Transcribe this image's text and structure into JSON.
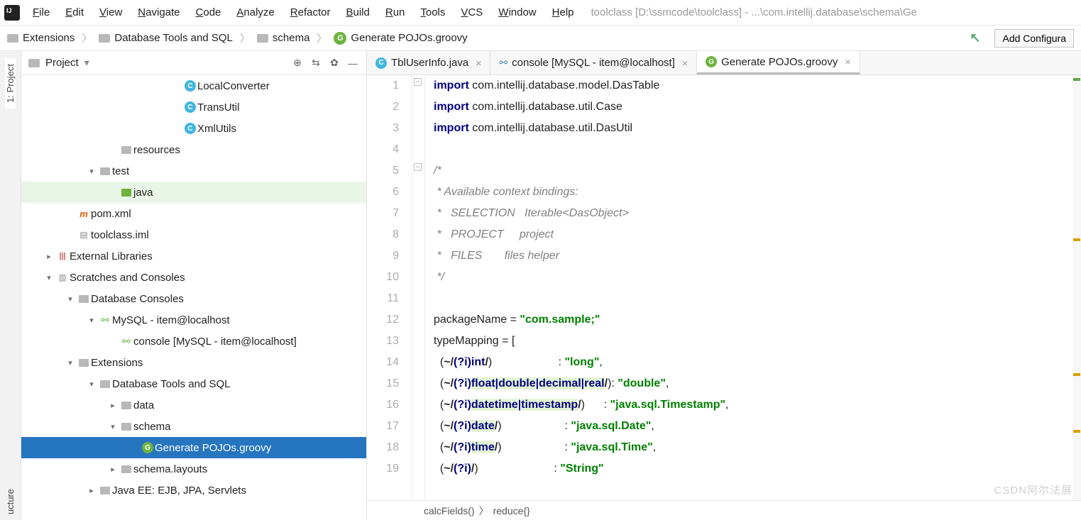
{
  "menu": {
    "items": [
      "File",
      "Edit",
      "View",
      "Navigate",
      "Code",
      "Analyze",
      "Refactor",
      "Build",
      "Run",
      "Tools",
      "VCS",
      "Window",
      "Help"
    ],
    "title": "toolclass [D:\\ssmcode\\toolclass] - ...\\com.intellij.database\\schema\\Ge"
  },
  "breadcrumbs": {
    "items": [
      "Extensions",
      "Database Tools and SQL",
      "schema",
      "Generate POJOs.groovy"
    ],
    "add_config": "Add Configura"
  },
  "project_panel": {
    "title": "Project",
    "tree": [
      {
        "indent": 210,
        "chev": "",
        "icon": "cblue",
        "label": "LocalConverter"
      },
      {
        "indent": 210,
        "chev": "",
        "icon": "cblue",
        "label": "TransUtil"
      },
      {
        "indent": 210,
        "chev": "",
        "icon": "cblue",
        "label": "XmlUtils"
      },
      {
        "indent": 120,
        "chev": "",
        "icon": "folder",
        "label": "resources"
      },
      {
        "indent": 90,
        "chev": "v",
        "icon": "folder",
        "label": "test"
      },
      {
        "indent": 120,
        "chev": "",
        "icon": "folder-green",
        "label": "java",
        "highlight": true
      },
      {
        "indent": 60,
        "chev": "",
        "icon": "m",
        "label": "pom.xml"
      },
      {
        "indent": 60,
        "chev": "",
        "icon": "file",
        "label": "toolclass.iml"
      },
      {
        "indent": 30,
        "chev": ">",
        "icon": "lib",
        "label": "External Libraries"
      },
      {
        "indent": 30,
        "chev": "v",
        "icon": "scratch",
        "label": "Scratches and Consoles"
      },
      {
        "indent": 60,
        "chev": "v",
        "icon": "folder",
        "label": "Database Consoles"
      },
      {
        "indent": 90,
        "chev": "v",
        "icon": "db",
        "label": "MySQL - item@localhost"
      },
      {
        "indent": 120,
        "chev": "",
        "icon": "db",
        "label": "console [MySQL - item@localhost]"
      },
      {
        "indent": 60,
        "chev": "v",
        "icon": "folder",
        "label": "Extensions"
      },
      {
        "indent": 90,
        "chev": "v",
        "icon": "folder",
        "label": "Database Tools and SQL"
      },
      {
        "indent": 120,
        "chev": ">",
        "icon": "folder",
        "label": "data"
      },
      {
        "indent": 120,
        "chev": "v",
        "icon": "folder",
        "label": "schema"
      },
      {
        "indent": 150,
        "chev": "",
        "icon": "g",
        "label": "Generate POJOs.groovy",
        "selected": true
      },
      {
        "indent": 120,
        "chev": ">",
        "icon": "folder",
        "label": "schema.layouts"
      },
      {
        "indent": 90,
        "chev": ">",
        "icon": "folder",
        "label": "Java EE: EJB, JPA, Servlets"
      }
    ]
  },
  "tabs": [
    {
      "icon": "cjava",
      "label": "TblUserInfo.java",
      "active": false
    },
    {
      "icon": "dbcon",
      "label": "console [MySQL - item@localhost]",
      "active": false
    },
    {
      "icon": "g",
      "label": "Generate POJOs.groovy",
      "active": true
    }
  ],
  "code_lines": [
    {
      "n": 1,
      "html": "<span class='kw'>import</span> com.intellij.database.model.DasTable"
    },
    {
      "n": 2,
      "html": "<span class='kw'>import</span> com.intellij.database.util.Case"
    },
    {
      "n": 3,
      "html": "<span class='kw'>import</span> com.intellij.database.util.DasUtil"
    },
    {
      "n": 4,
      "html": ""
    },
    {
      "n": 5,
      "html": "<span class='comment'>/*</span>"
    },
    {
      "n": 6,
      "html": "<span class='comment'> * Available context bindings:</span>"
    },
    {
      "n": 7,
      "html": "<span class='comment'> *   SELECTION   Iterable&lt;DasObject&gt;</span>"
    },
    {
      "n": 8,
      "html": "<span class='comment'> *   PROJECT     project</span>"
    },
    {
      "n": 9,
      "html": "<span class='comment'> *   FILES       files helper</span>"
    },
    {
      "n": 10,
      "html": "<span class='comment'> */</span>"
    },
    {
      "n": 11,
      "html": ""
    },
    {
      "n": 12,
      "html": "packageName = <span class='str'>\"com.sample;\"</span>"
    },
    {
      "n": 13,
      "html": "typeMapping = ["
    },
    {
      "n": 14,
      "html": "  (<span class='regex'>~/<span class='rx-txt'>(?i)int</span>/</span>)                     : <span class='str'>\"long\"</span>,"
    },
    {
      "n": 15,
      "html": "  (<span class='regex'>~/<span class='rx-txt'>(?i)<span class='hl'>float</span>|<span class='hl'>double</span>|<span class='hl'>decimal</span>|<span class='hl'>real</span></span>/</span>): <span class='str'>\"double\"</span>,"
    },
    {
      "n": 16,
      "html": "  (<span class='regex'>~/<span class='rx-txt'>(?i)<span class='hl'>datetime</span>|<span class='hl'>timestamp</span></span>/</span>)      : <span class='str'>\"java.sql.Timestamp\"</span>,"
    },
    {
      "n": 17,
      "html": "  (<span class='regex'>~/<span class='rx-txt'>(?i)<span class='hl'>date</span></span>/</span>)                    : <span class='str'>\"java.sql.Date\"</span>,"
    },
    {
      "n": 18,
      "html": "  (<span class='regex'>~/<span class='rx-txt'>(?i)<span class='hl'>time</span></span>/</span>)                    : <span class='str'>\"java.sql.Time\"</span>,"
    },
    {
      "n": 19,
      "html": "  (<span class='regex'>~/<span class='rx-txt'>(?i)</span>/</span>)                        : <span class='str'>\"String\"</span>"
    }
  ],
  "code_breadcrumb": [
    "calcFields()",
    "reduce{}"
  ],
  "rail": {
    "project": "1: Project",
    "structure": "ucture"
  },
  "watermark": "CSDN阿尔法展"
}
